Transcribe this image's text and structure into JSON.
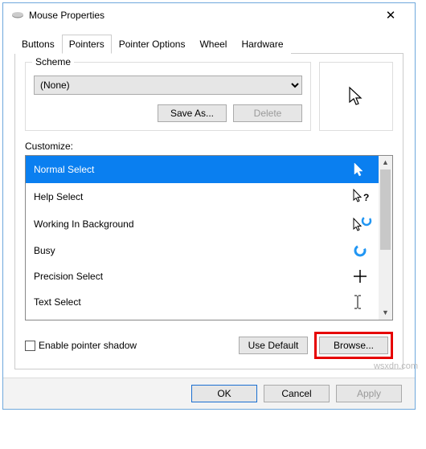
{
  "window": {
    "title": "Mouse Properties",
    "close": "✕"
  },
  "tabs": [
    "Buttons",
    "Pointers",
    "Pointer Options",
    "Wheel",
    "Hardware"
  ],
  "active_tab": "Pointers",
  "scheme": {
    "legend": "Scheme",
    "selected": "(None)",
    "save_as": "Save As...",
    "delete": "Delete"
  },
  "customize_label": "Customize:",
  "cursors": [
    {
      "name": "Normal Select",
      "icon": "arrow",
      "selected": true
    },
    {
      "name": "Help Select",
      "icon": "arrow-help",
      "selected": false
    },
    {
      "name": "Working In Background",
      "icon": "arrow-busy",
      "selected": false
    },
    {
      "name": "Busy",
      "icon": "busy",
      "selected": false
    },
    {
      "name": "Precision Select",
      "icon": "cross",
      "selected": false
    },
    {
      "name": "Text Select",
      "icon": "ibeam",
      "selected": false
    }
  ],
  "shadow_label": "Enable pointer shadow",
  "use_default": "Use Default",
  "browse": "Browse...",
  "dlg": {
    "ok": "OK",
    "cancel": "Cancel",
    "apply": "Apply"
  },
  "watermark": "wsxdn.com"
}
